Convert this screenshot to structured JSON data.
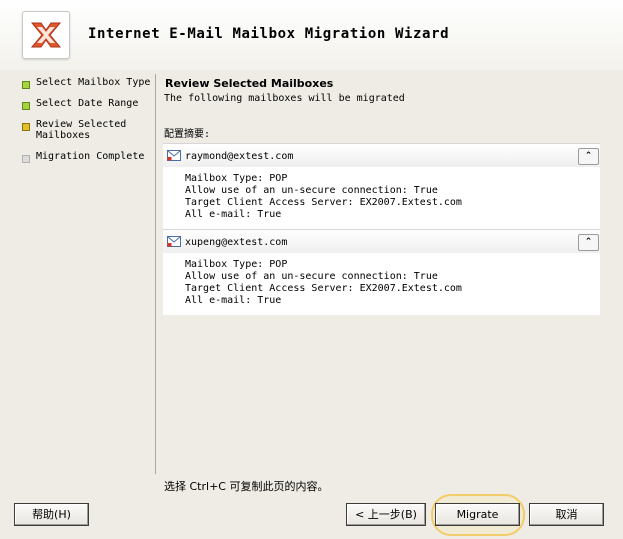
{
  "wizard": {
    "title": "Internet E-Mail Mailbox Migration Wizard",
    "logo_icon": "exchange-logo-icon"
  },
  "steps": [
    {
      "label": "Select Mailbox Type",
      "state": "done"
    },
    {
      "label": "Select Date Range",
      "state": "done"
    },
    {
      "label": "Review Selected Mailboxes",
      "state": "current"
    },
    {
      "label": "Migration Complete",
      "state": "pending"
    }
  ],
  "content": {
    "title": "Review Selected Mailboxes",
    "subtitle": "The following mailboxes will be migrated",
    "summary_label": "配置摘要:",
    "mailboxes": [
      {
        "name": "raymond@extest.com",
        "lines": [
          "Mailbox Type: POP",
          "Allow use of an un-secure connection: True",
          "Target Client Access Server: EX2007.Extest.com",
          "All e-mail: True"
        ]
      },
      {
        "name": "xupeng@extest.com",
        "lines": [
          "Mailbox Type: POP",
          "Allow use of an un-secure connection: True",
          "Target Client Access Server: EX2007.Extest.com",
          "All e-mail: True"
        ]
      }
    ],
    "collapse_glyph": "⌃",
    "copy_hint": "选择 Ctrl+C 可复制此页的内容。"
  },
  "buttons": {
    "help": "帮助(H)",
    "back": "< 上一步(B)",
    "migrate": "Migrate",
    "cancel": "取消"
  },
  "colors": {
    "step_done": "#a6d33c",
    "step_current": "#e2c02c",
    "step_pending": "#dcdcdc",
    "highlight": "#f2cc6b"
  }
}
